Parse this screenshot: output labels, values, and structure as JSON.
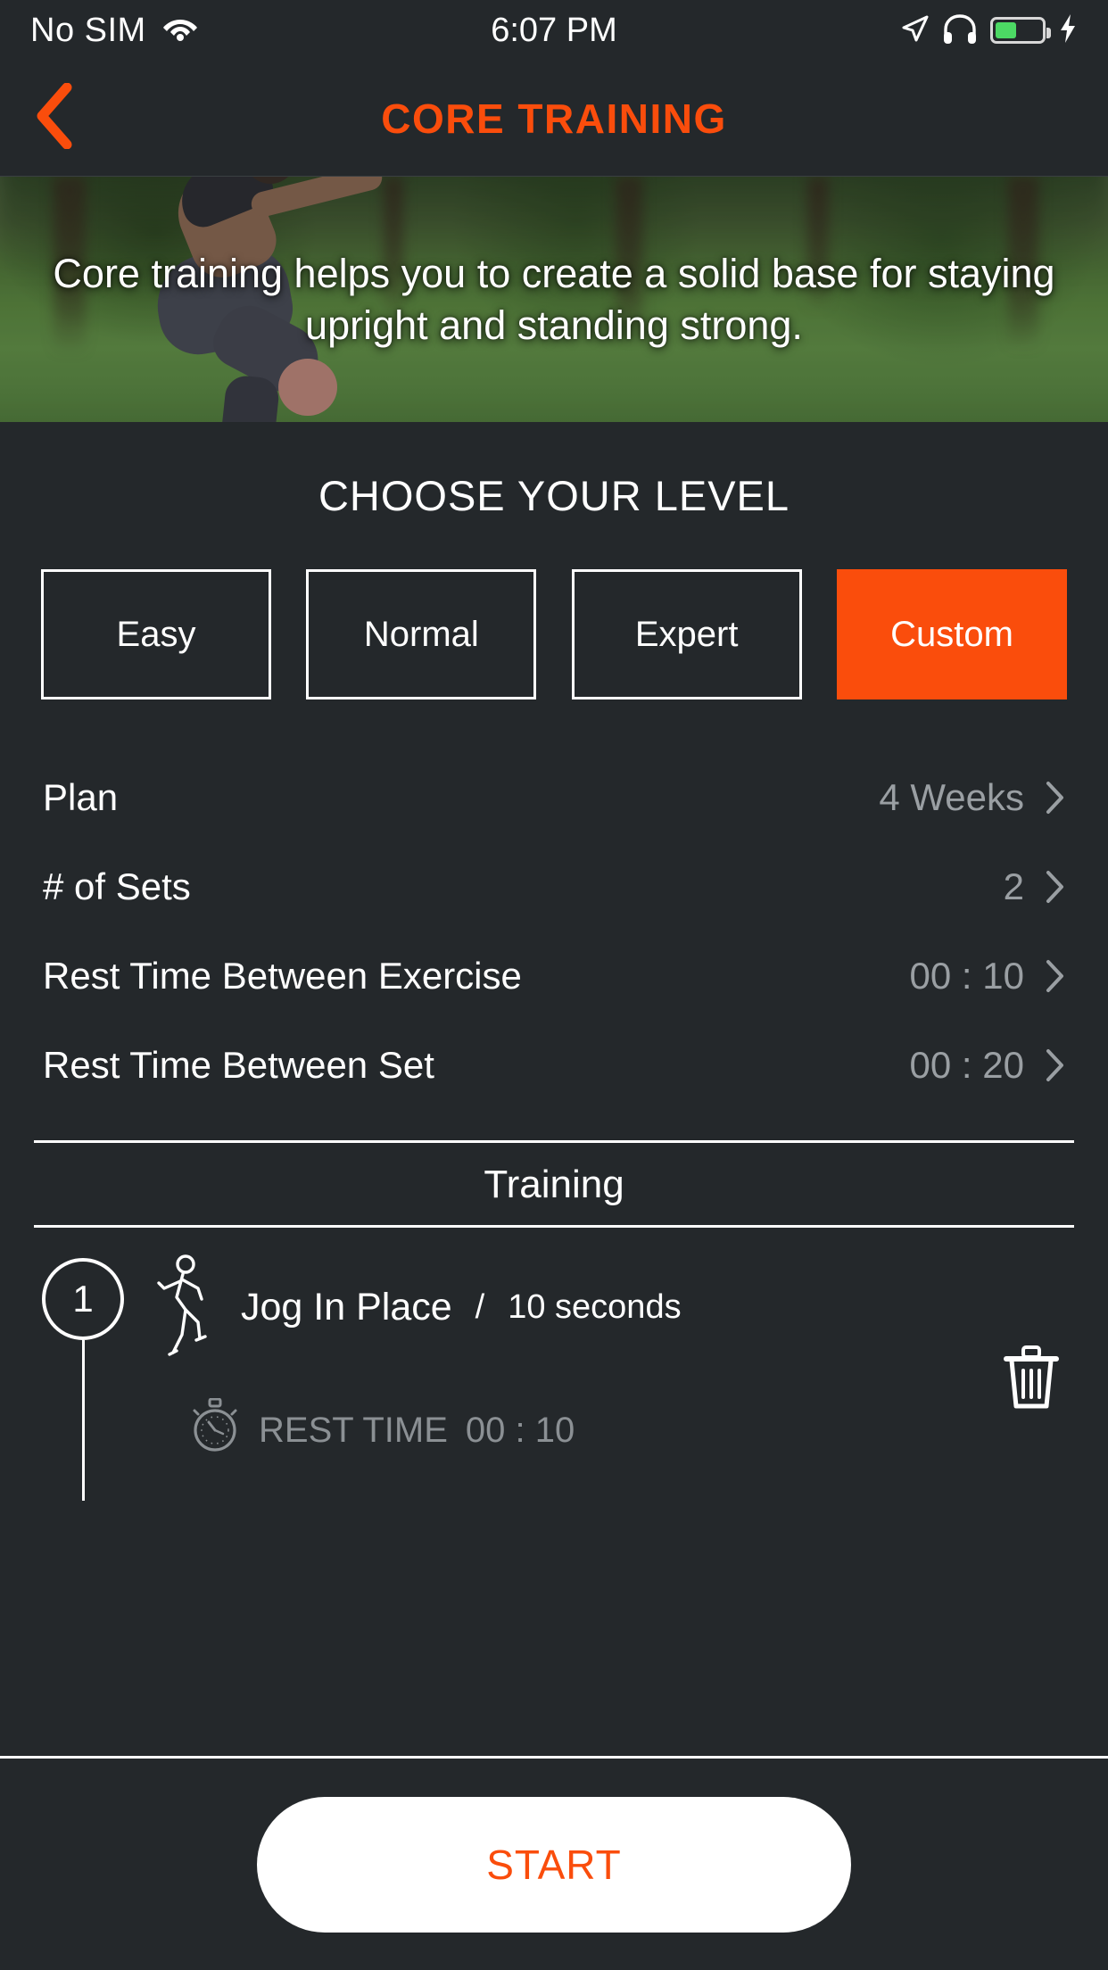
{
  "status_bar": {
    "carrier": "No SIM",
    "time": "6:07 PM",
    "wifi_icon": "wifi-icon",
    "location_icon": "location-arrow-icon",
    "headphones_icon": "headphones-icon",
    "battery_icon": "battery-icon",
    "charging_icon": "lightning-bolt-icon"
  },
  "nav": {
    "back_icon": "back-chevron-icon",
    "title": "CORE TRAINING"
  },
  "hero": {
    "description": "Core training helps you to create a solid base for staying upright and standing strong."
  },
  "level": {
    "heading": "CHOOSE YOUR LEVEL",
    "options": [
      {
        "label": "Easy",
        "selected": false
      },
      {
        "label": "Normal",
        "selected": false
      },
      {
        "label": "Expert",
        "selected": false
      },
      {
        "label": "Custom",
        "selected": true
      }
    ]
  },
  "settings": [
    {
      "label": "Plan",
      "value": "4 Weeks"
    },
    {
      "label": "# of Sets",
      "value": "2"
    },
    {
      "label": "Rest Time Between Exercise",
      "value": "00 : 10"
    },
    {
      "label": "Rest Time Between Set",
      "value": "00 : 20"
    }
  ],
  "training": {
    "heading": "Training",
    "exercises": [
      {
        "index": "1",
        "icon": "running-person-icon",
        "name": "Jog In Place",
        "separator": "/",
        "duration": "10 seconds",
        "rest_icon": "stopwatch-icon",
        "rest_label": "REST TIME",
        "rest_value": "00 : 10",
        "delete_icon": "trash-icon"
      }
    ]
  },
  "footer": {
    "start_label": "START"
  },
  "colors": {
    "accent_orange": "#fa4d0c",
    "background": "#24282b",
    "text_primary": "#ffffff",
    "text_muted": "#9a9fa3",
    "battery_green": "#4cd964"
  }
}
